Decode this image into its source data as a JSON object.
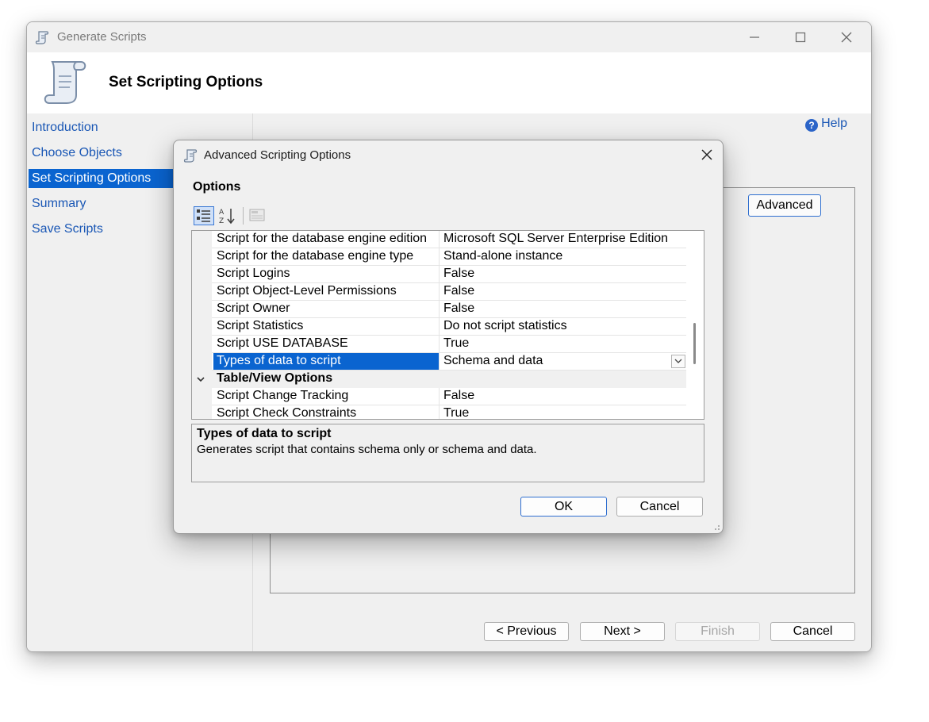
{
  "window": {
    "title": "Generate Scripts",
    "header_title": "Set Scripting Options"
  },
  "nav": {
    "items": [
      {
        "label": "Introduction",
        "active": false
      },
      {
        "label": "Choose Objects",
        "active": false
      },
      {
        "label": "Set Scripting Options",
        "active": true
      },
      {
        "label": "Summary",
        "active": false
      },
      {
        "label": "Save Scripts",
        "active": false
      }
    ]
  },
  "content": {
    "help_label": "Help",
    "advanced_label": "Advanced"
  },
  "footer": {
    "previous_label": "< Previous",
    "next_label": "Next >",
    "finish_label": "Finish",
    "cancel_label": "Cancel"
  },
  "dialog": {
    "title": "Advanced Scripting Options",
    "options_label": "Options",
    "rows": [
      {
        "name": "Script for the database engine edition",
        "value": "Microsoft SQL Server Enterprise Edition"
      },
      {
        "name": "Script for the database engine type",
        "value": "Stand-alone instance"
      },
      {
        "name": "Script Logins",
        "value": "False"
      },
      {
        "name": "Script Object-Level Permissions",
        "value": "False"
      },
      {
        "name": "Script Owner",
        "value": "False"
      },
      {
        "name": "Script Statistics",
        "value": "Do not script statistics"
      },
      {
        "name": "Script USE DATABASE",
        "value": "True"
      },
      {
        "name": "Types of data to script",
        "value": "Schema and data"
      }
    ],
    "category": "Table/View Options",
    "category_rows": [
      {
        "name": "Script Change Tracking",
        "value": "False"
      },
      {
        "name": "Script Check Constraints",
        "value": "True"
      }
    ],
    "description_title": "Types of data to script",
    "description_text": "Generates script that contains schema only or schema and data.",
    "ok_label": "OK",
    "cancel_label": "Cancel"
  },
  "colors": {
    "accent": "#0a64d0",
    "link": "#1a57b5"
  }
}
